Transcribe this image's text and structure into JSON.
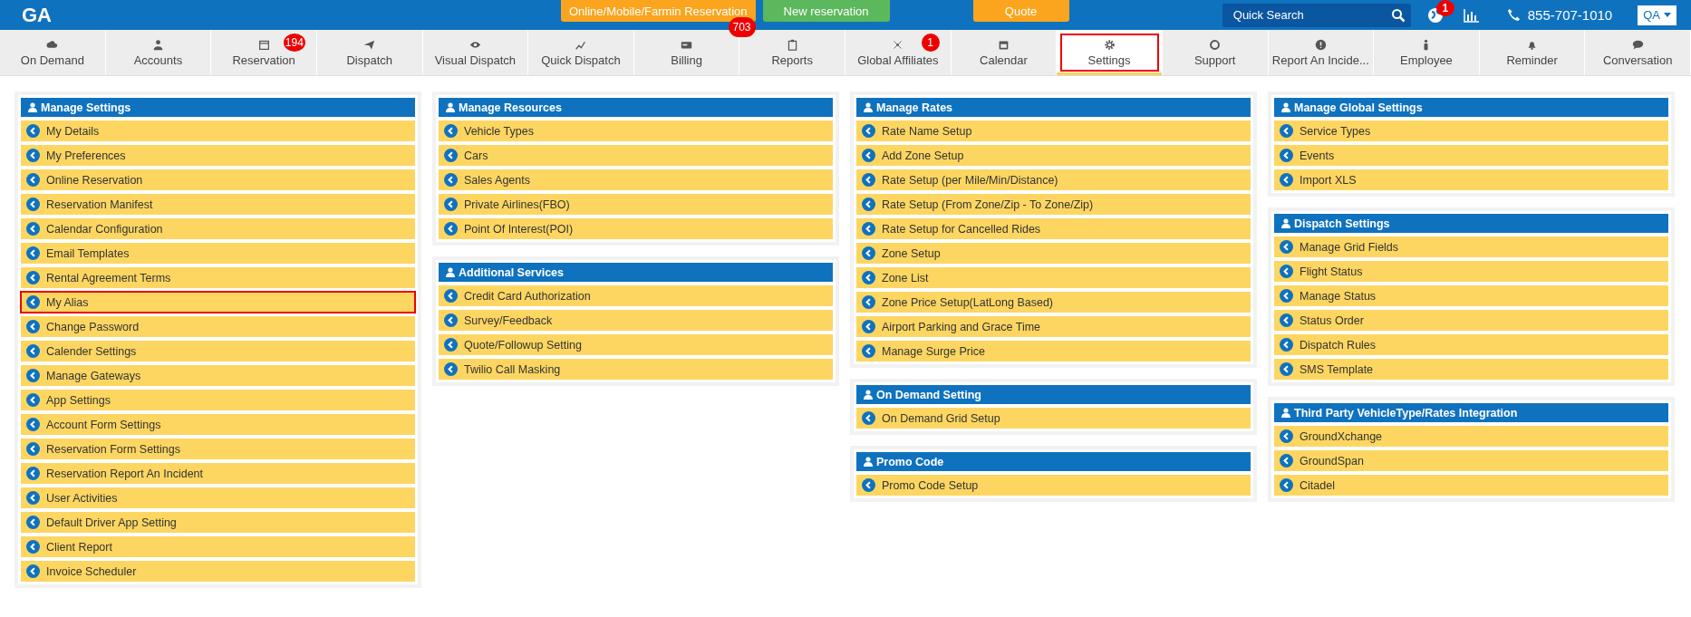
{
  "app": {
    "logo": "GA"
  },
  "top_buttons": [
    {
      "label": "Online/Mobile/Farmin Reservation",
      "kind": "orange",
      "badge": "703"
    },
    {
      "label": "New reservation",
      "kind": "green"
    },
    {
      "label": "Quote",
      "kind": "orange"
    }
  ],
  "search": {
    "placeholder": "Quick Search"
  },
  "notifications": {
    "badge": "1"
  },
  "phone": "855-707-1010",
  "user_menu": {
    "label": "QA"
  },
  "nav_tabs": [
    {
      "label": "On Demand",
      "selected": false
    },
    {
      "label": "Accounts",
      "selected": false
    },
    {
      "label": "Reservation",
      "selected": false,
      "badge": "194"
    },
    {
      "label": "Dispatch",
      "selected": false
    },
    {
      "label": "Visual Dispatch",
      "selected": false
    },
    {
      "label": "Quick Dispatch",
      "selected": false
    },
    {
      "label": "Billing",
      "selected": false
    },
    {
      "label": "Reports",
      "selected": false
    },
    {
      "label": "Global Affiliates",
      "selected": false,
      "badge": "1"
    },
    {
      "label": "Calendar",
      "selected": false
    },
    {
      "label": "Settings",
      "selected": true
    },
    {
      "label": "Support",
      "selected": false
    },
    {
      "label": "Report An Incide...",
      "selected": false
    },
    {
      "label": "Employee",
      "selected": false
    },
    {
      "label": "Reminder",
      "selected": false
    },
    {
      "label": "Conversation",
      "selected": false
    }
  ],
  "columns": [
    [
      {
        "title": "Manage Settings",
        "items": [
          {
            "label": "My Details",
            "highlighted": false
          },
          {
            "label": "My Preferences",
            "highlighted": false
          },
          {
            "label": "Online Reservation",
            "highlighted": false
          },
          {
            "label": "Reservation Manifest",
            "highlighted": false
          },
          {
            "label": "Calendar Configuration",
            "highlighted": false
          },
          {
            "label": "Email Templates",
            "highlighted": false
          },
          {
            "label": "Rental Agreement Terms",
            "highlighted": false
          },
          {
            "label": "My Alias",
            "highlighted": true
          },
          {
            "label": "Change Password",
            "highlighted": false
          },
          {
            "label": "Calender Settings",
            "highlighted": false
          },
          {
            "label": "Manage Gateways",
            "highlighted": false
          },
          {
            "label": "App Settings",
            "highlighted": false
          },
          {
            "label": "Account Form Settings",
            "highlighted": false
          },
          {
            "label": "Reservation Form Settings",
            "highlighted": false
          },
          {
            "label": "Reservation Report An Incident",
            "highlighted": false
          },
          {
            "label": "User Activities",
            "highlighted": false
          },
          {
            "label": "Default Driver App Setting",
            "highlighted": false
          },
          {
            "label": "Client Report",
            "highlighted": false
          },
          {
            "label": "Invoice Scheduler",
            "highlighted": false
          }
        ]
      }
    ],
    [
      {
        "title": "Manage Resources",
        "items": [
          {
            "label": "Vehicle Types",
            "highlighted": false
          },
          {
            "label": "Cars",
            "highlighted": false
          },
          {
            "label": "Sales Agents",
            "highlighted": false
          },
          {
            "label": "Private Airlines(FBO)",
            "highlighted": false
          },
          {
            "label": "Point Of Interest(POI)",
            "highlighted": false
          }
        ]
      },
      {
        "title": "Additional Services",
        "items": [
          {
            "label": "Credit Card Authorization",
            "highlighted": false
          },
          {
            "label": "Survey/Feedback",
            "highlighted": false
          },
          {
            "label": "Quote/Followup Setting",
            "highlighted": false
          },
          {
            "label": "Twilio Call Masking",
            "highlighted": false
          }
        ]
      }
    ],
    [
      {
        "title": "Manage Rates",
        "items": [
          {
            "label": "Rate Name Setup",
            "highlighted": false
          },
          {
            "label": "Add Zone Setup",
            "highlighted": false
          },
          {
            "label": "Rate Setup (per Mile/Min/Distance)",
            "highlighted": false
          },
          {
            "label": "Rate Setup (From Zone/Zip - To Zone/Zip)",
            "highlighted": false
          },
          {
            "label": "Rate Setup for Cancelled Rides",
            "highlighted": false
          },
          {
            "label": "Zone Setup",
            "highlighted": false
          },
          {
            "label": "Zone List",
            "highlighted": false
          },
          {
            "label": "Zone Price Setup(LatLong Based)",
            "highlighted": false
          },
          {
            "label": "Airport Parking and Grace Time",
            "highlighted": false
          },
          {
            "label": "Manage Surge Price",
            "highlighted": false
          }
        ]
      },
      {
        "title": "On Demand Setting",
        "items": [
          {
            "label": "On Demand Grid Setup",
            "highlighted": false
          }
        ]
      },
      {
        "title": "Promo Code",
        "items": [
          {
            "label": "Promo Code Setup",
            "highlighted": false
          }
        ]
      }
    ],
    [
      {
        "title": "Manage Global Settings",
        "items": [
          {
            "label": "Service Types",
            "highlighted": false
          },
          {
            "label": "Events",
            "highlighted": false
          },
          {
            "label": "Import XLS",
            "highlighted": false
          }
        ]
      },
      {
        "title": "Dispatch Settings",
        "items": [
          {
            "label": "Manage Grid Fields",
            "highlighted": false
          },
          {
            "label": "Flight Status",
            "highlighted": false
          },
          {
            "label": "Manage Status",
            "highlighted": false
          },
          {
            "label": "Status Order",
            "highlighted": false
          },
          {
            "label": "Dispatch Rules",
            "highlighted": false
          },
          {
            "label": "SMS Template",
            "highlighted": false
          }
        ]
      },
      {
        "title": "Third Party VehicleType/Rates Integration",
        "items": [
          {
            "label": "GroundXchange",
            "highlighted": false
          },
          {
            "label": "GroundSpan",
            "highlighted": false
          },
          {
            "label": "Citadel",
            "highlighted": false
          }
        ]
      }
    ]
  ]
}
